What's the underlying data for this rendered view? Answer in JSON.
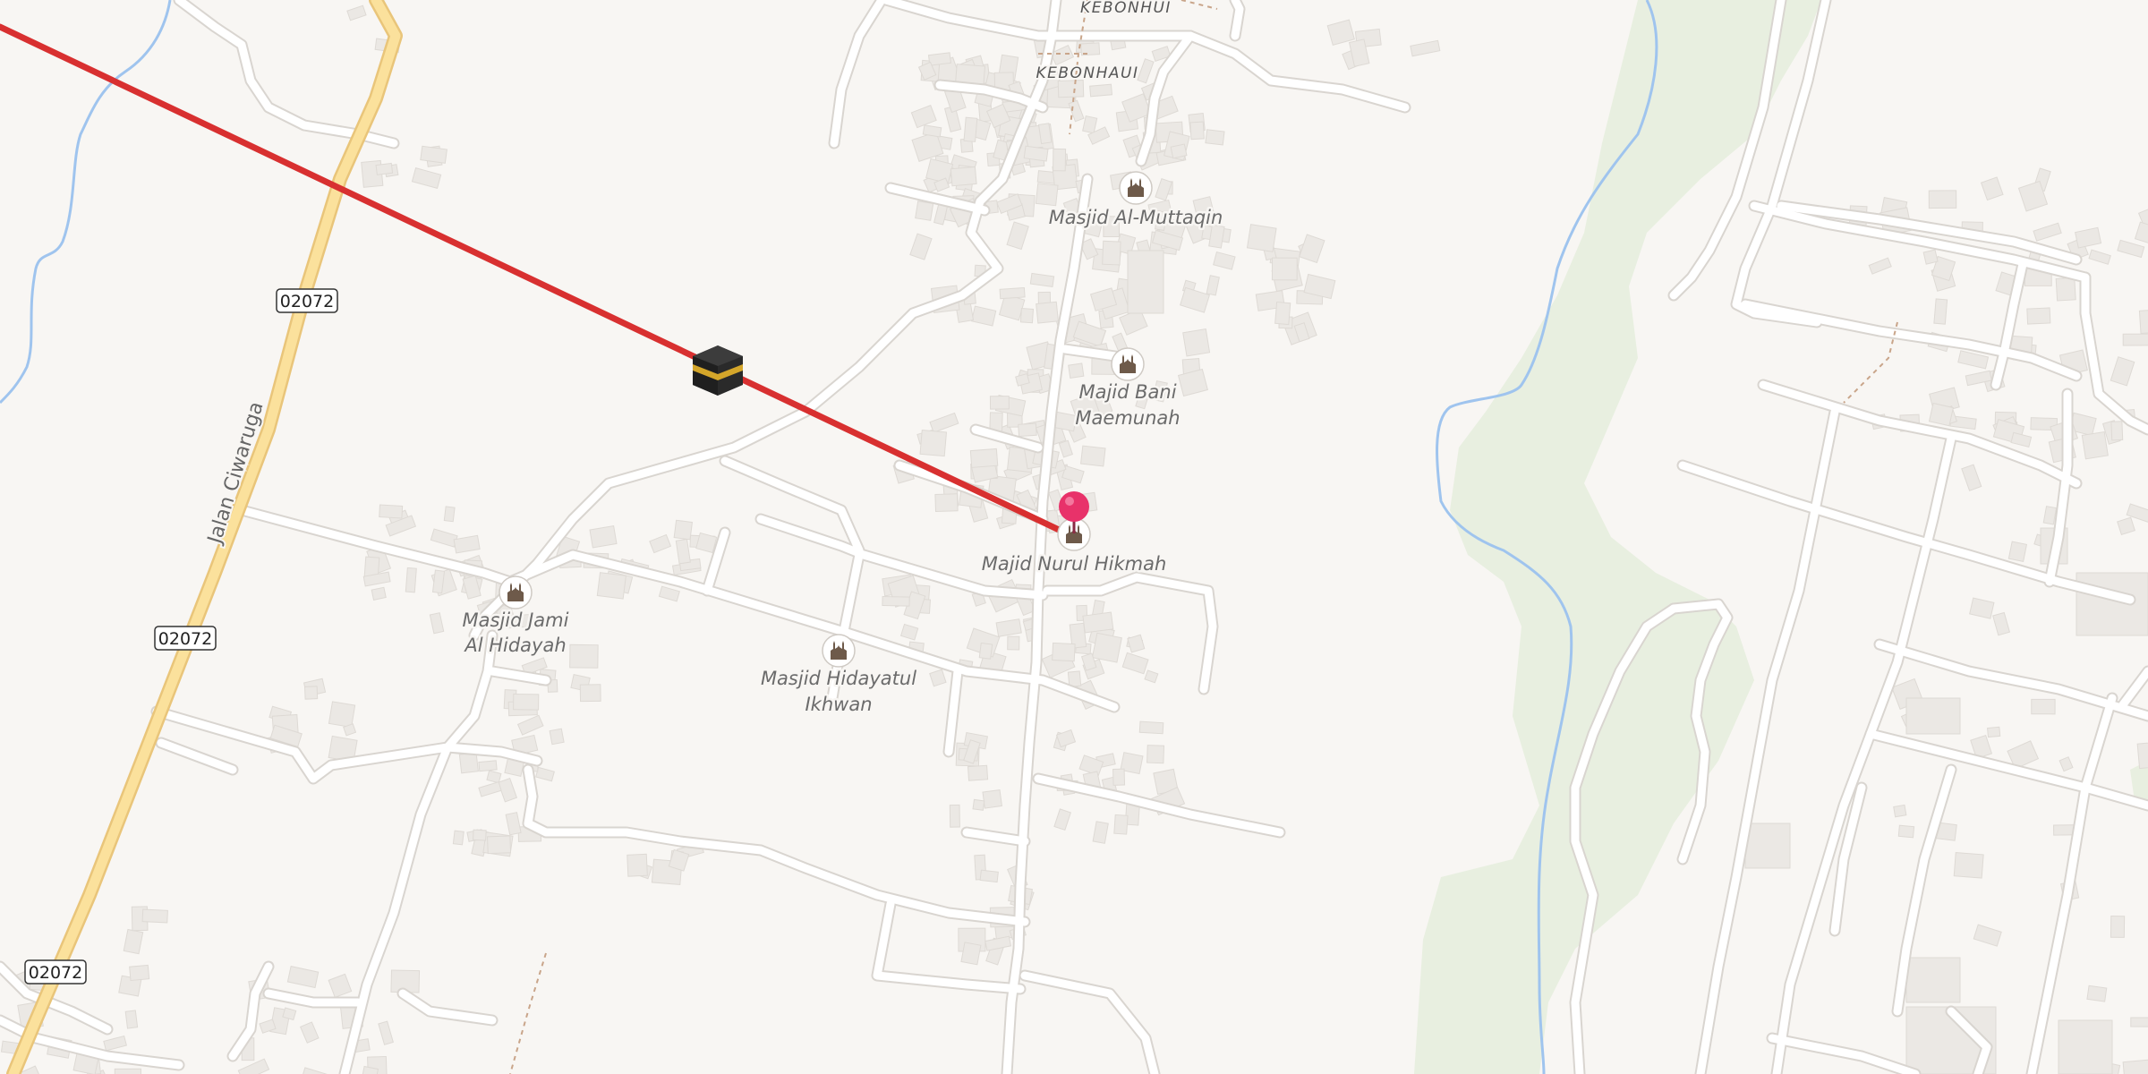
{
  "map": {
    "colors": {
      "background": "#f8f6f3",
      "road": "#ffffff",
      "road_casing": "#d9d5d0",
      "main_road": "#fbe19c",
      "main_road_casing": "#e9c57a",
      "water": "#9fc4ee",
      "green": "#e8efe0",
      "building": "#ebe8e4",
      "qibla_line": "#d83030",
      "marker": "#e8326a"
    },
    "area_labels": [
      {
        "name": "kebonhui-top-label",
        "text": "KEBONHUI"
      },
      {
        "name": "kebonhaui-label",
        "text": "KEBONHAUI"
      }
    ],
    "road_label": "Jalan Ciwaruga",
    "road_shields": [
      "02072",
      "02072",
      "02072"
    ],
    "pois": [
      {
        "name": "masjid-al-muttaqin",
        "lines": [
          "Masjid Al-Muttaqin"
        ],
        "icon": "mosque-icon"
      },
      {
        "name": "majid-bani-maemunah",
        "lines": [
          "Majid Bani",
          "Maemunah"
        ],
        "icon": "mosque-icon"
      },
      {
        "name": "majid-nurul-hikmah",
        "lines": [
          "Majid Nurul Hikmah"
        ],
        "icon": "mosque-icon"
      },
      {
        "name": "masjid-jami-al-hidayah",
        "lines": [
          "Masjid Jami",
          "Al Hidayah"
        ],
        "icon": "mosque-icon"
      },
      {
        "name": "masjid-hidayatul-ikhwan",
        "lines": [
          "Masjid Hidayatul",
          "Ikhwan"
        ],
        "icon": "mosque-icon"
      }
    ],
    "qibla": {
      "icon": "kaaba-icon"
    },
    "location_marker": {
      "icon": "map-pin-icon"
    }
  }
}
